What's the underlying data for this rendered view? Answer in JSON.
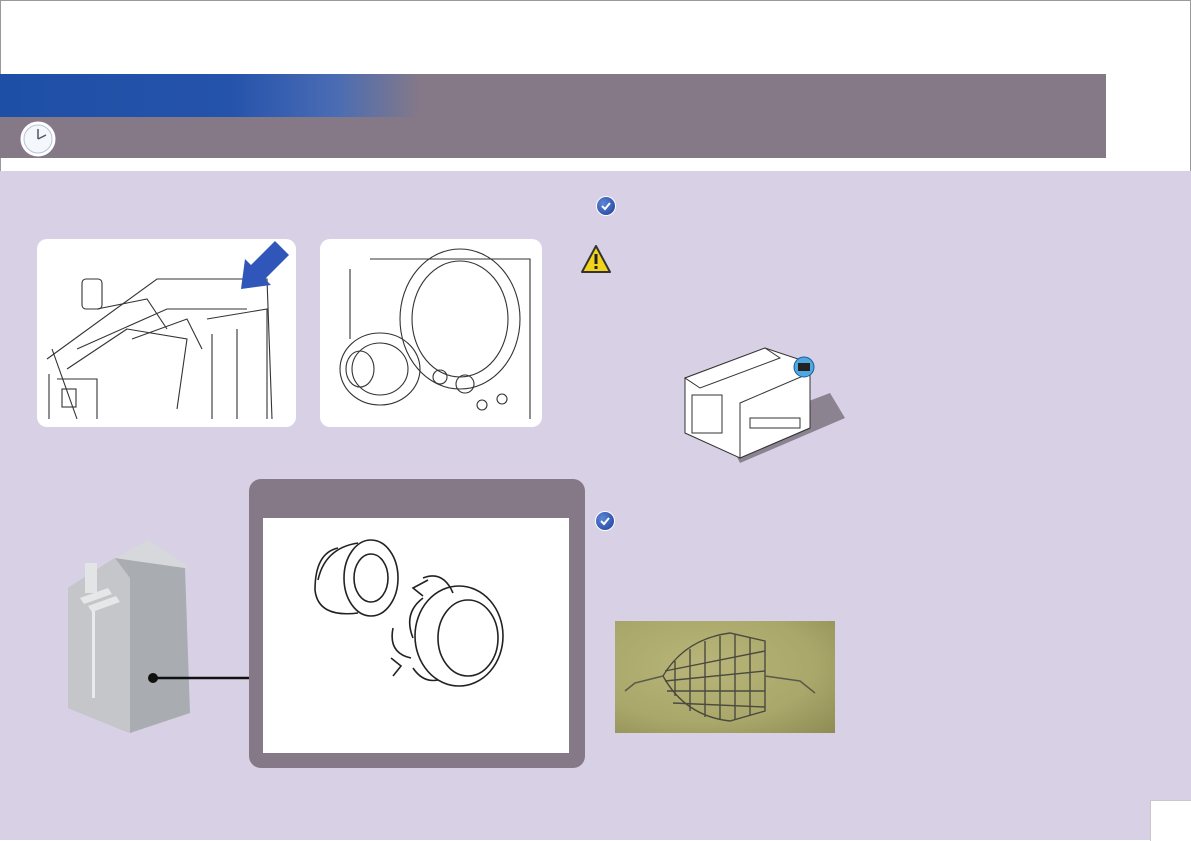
{
  "header": {
    "title": "",
    "icon": "clock-icon",
    "colors": {
      "band": "#857988",
      "accent_blue": "#2553ab",
      "content_bg": "#d8d0e4"
    }
  },
  "left": {
    "photos": [
      {
        "name": "top-assembly-photo",
        "callout": "blue-arrow"
      },
      {
        "name": "gear-assembly-photo"
      }
    ],
    "detail_panel": {
      "label": "",
      "content": "bushing-and-gear-drawing"
    }
  },
  "right": {
    "notes": [
      {
        "icon": "checkmark-icon",
        "text": ""
      },
      {
        "icon": "warning-icon",
        "text": ""
      },
      {
        "icon": "checkmark-icon",
        "text": ""
      }
    ],
    "images": [
      "unit-isometric-drawing",
      "wire-cage-photo"
    ]
  },
  "footer": {
    "page_number": ""
  }
}
